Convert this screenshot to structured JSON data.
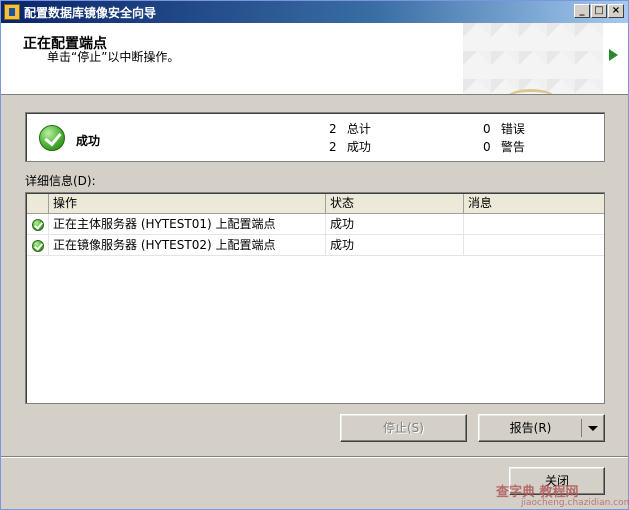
{
  "window": {
    "title": "配置数据库镜像安全向导",
    "min_label": "_",
    "max_label": "□",
    "close_label": "×"
  },
  "banner": {
    "title": "正在配置端点",
    "subtitle": "单击“停止”以中断操作。",
    "arrow_color": "#2a8a2a"
  },
  "summary": {
    "status": "成功",
    "total_count": "2",
    "total_label": "总计",
    "success_count": "2",
    "success_label": "成功",
    "error_count": "0",
    "error_label": "错误",
    "warning_count": "0",
    "warning_label": "警告"
  },
  "details": {
    "label": "详细信息(D):",
    "columns": [
      "操作",
      "状态",
      "消息"
    ],
    "rows": [
      {
        "action": "正在主体服务器 (HYTEST01) 上配置端点",
        "status": "成功",
        "message": ""
      },
      {
        "action": "正在镜像服务器 (HYTEST02) 上配置端点",
        "status": "成功",
        "message": ""
      }
    ]
  },
  "buttons": {
    "stop": "停止(S)",
    "report": "报告(R)",
    "close": "关闭"
  },
  "watermark": {
    "text": "查字典 教程网",
    "sub": "jiaocheng.chazidian.com"
  },
  "colors": {
    "title_bar": "#0a246a",
    "success_green": "#48b030"
  }
}
